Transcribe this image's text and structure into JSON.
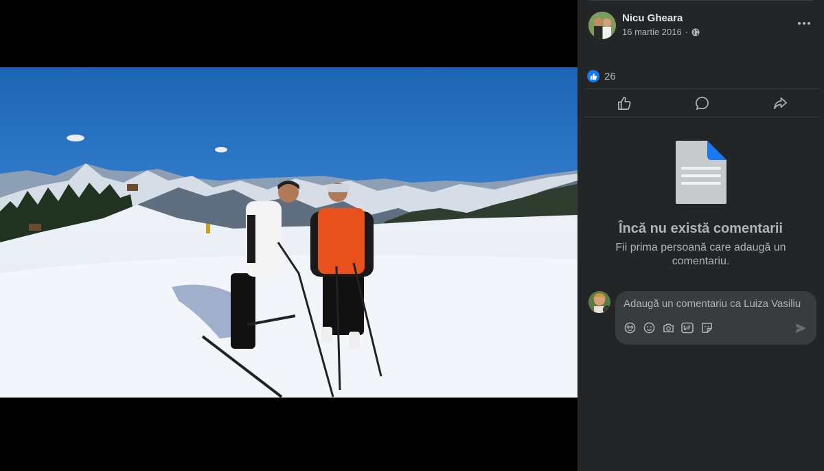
{
  "post": {
    "author_name": "Nicu Gheara",
    "date": "16 martie 2016",
    "privacy_icon": "globe-icon"
  },
  "reactions": {
    "count": "26",
    "icon": "like-icon"
  },
  "actions": [
    {
      "name": "like",
      "icon": "thumbs-up-icon"
    },
    {
      "name": "comment",
      "icon": "comment-bubble-icon"
    },
    {
      "name": "share",
      "icon": "share-arrow-icon"
    }
  ],
  "comments": {
    "empty_title": "Încă nu există comentarii",
    "empty_subtitle": "Fii prima persoană care adaugă un comentariu."
  },
  "composer": {
    "placeholder": "Adaugă un comentariu ca Luiza Vasiliu",
    "tools": [
      "avatar-sticker-icon",
      "emoji-icon",
      "camera-icon",
      "gif-icon",
      "sticker-icon"
    ],
    "send_icon": "send-icon"
  },
  "colors": {
    "panel_bg": "#242526",
    "accent": "#1877f2",
    "text_primary": "#e4e6eb",
    "text_secondary": "#b0b3b8"
  }
}
